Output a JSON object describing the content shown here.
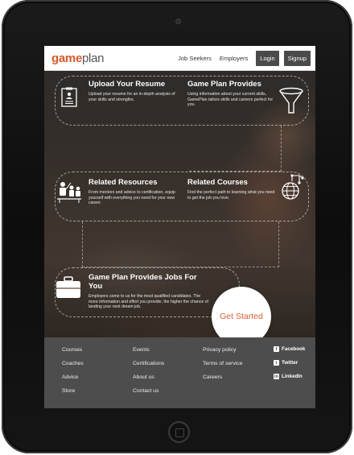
{
  "header": {
    "logo_game": "game",
    "logo_plan": "plan",
    "nav_job_seekers": "Job Seekers",
    "nav_employers": "Employers",
    "login_label": "Login",
    "signup_label": "Signup"
  },
  "features": [
    {
      "title": "Upload Your Resume",
      "desc": "Upload your resume for an in-depth analysis of your skills and strengths.",
      "icon": "resume-icon"
    },
    {
      "title": "Game Plan Provides",
      "desc": "Using information about your current skills, GamePlan tailors skills and careers perfect for you.",
      "icon": "funnel-icon"
    },
    {
      "title": "Related Resources",
      "desc": "From mentors and advice to certification, equip yourself with everything you need for your new career.",
      "icon": "people-icon"
    },
    {
      "title": "Related Courses",
      "desc": "Find the perfect path to learning what you need to get the job you love.",
      "icon": "globe-icon"
    },
    {
      "title": "Game Plan Provides Jobs For You",
      "desc": "Employers come to us for the most qualified candidates. The more information and effort you provide, the higher the chance of landing your next dream job.",
      "icon": "briefcase-icon"
    }
  ],
  "cta": {
    "label": "Get Started"
  },
  "footer": {
    "col1": [
      "Courses",
      "Coaches",
      "Advice",
      "Store"
    ],
    "col2": [
      "Events",
      "Certifications",
      "About us",
      "Contact us"
    ],
    "col3": [
      "Privacy policy",
      "Terms of service",
      "Careers"
    ],
    "social": [
      {
        "label": "Facebook",
        "icon": "facebook-icon"
      },
      {
        "label": "Twitter",
        "icon": "twitter-icon"
      },
      {
        "label": "LinkedIn",
        "icon": "linkedin-icon"
      }
    ]
  },
  "colors": {
    "brand_orange": "#d55a2b",
    "footer_bg": "#4d4d4d",
    "button_bg": "#4a4a4a"
  }
}
